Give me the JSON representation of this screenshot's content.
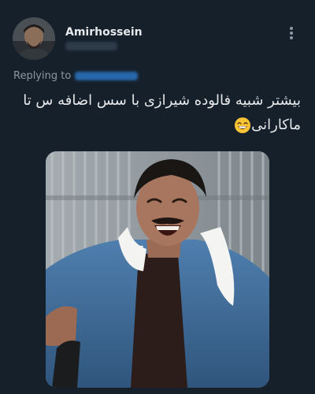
{
  "tweet": {
    "author": {
      "display_name": "Amirhossein",
      "handle": "@amirhgk"
    },
    "reply": {
      "label": "Replying to",
      "target": "@blurred_user"
    },
    "text": "بیشتر شبیه فالوده شیرازی با سس اضافه س تا ماکارانی",
    "emoji": "grinning-face-with-smiling-eyes"
  },
  "icons": {
    "more": "more-vertical-icon"
  },
  "colors": {
    "background": "#15202b",
    "primary_text": "#e7e9ea",
    "secondary_text": "#8b98a5",
    "link": "#1d9bf0"
  }
}
